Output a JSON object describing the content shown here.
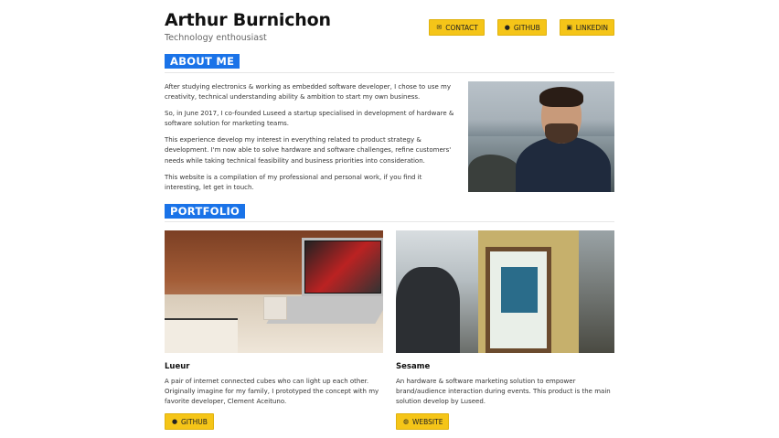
{
  "header": {
    "name": "Arthur Burnichon",
    "tagline": "Technology enthousiast",
    "buttons": [
      {
        "label": "CONTACT",
        "icon": "mail-icon"
      },
      {
        "label": "GITHUB",
        "icon": "github-icon"
      },
      {
        "label": "LINKEDIN",
        "icon": "linkedin-icon"
      }
    ]
  },
  "about": {
    "title": "ABOUT ME",
    "paragraphs": [
      "After studying electronics & working as embedded software developer, I chose to use my creativity, technical understanding ability & ambition to start my own business.",
      "So, in June 2017, I co-founded Luseed a startup specialised in development of hardware & software solution for marketing teams.",
      "This experience develop my interest in everything related to product strategy & development. I'm now able to solve hardware and software challenges, refine customers' needs while taking technical feasibility and business priorities into consideration.",
      "This website is a compilation of my professional and personal work, if you find it interesting, let get in touch."
    ]
  },
  "portfolio": {
    "title": "PORTFOLIO",
    "items": [
      {
        "title": "Lueur",
        "description": "A pair of internet connected cubes who can light up each other. Originally imagine for my family, I prototyped the concept with my favorite developer, Clement Aceituno.",
        "button_label": "GITHUB",
        "button_icon": "github-icon"
      },
      {
        "title": "Sesame",
        "description": "An hardware & software marketing solution to empower brand/audience interaction during events. This product is the main solution develop by Luseed.",
        "button_label": "WEBSITE",
        "button_icon": "globe-icon"
      }
    ]
  },
  "colors": {
    "accent_blue": "#1a73e8",
    "button_yellow": "#f5c518"
  }
}
